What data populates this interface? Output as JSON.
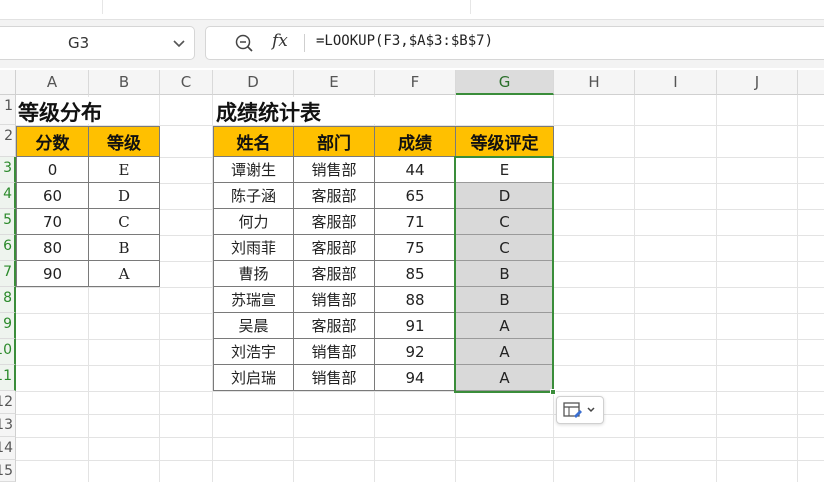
{
  "name_box": {
    "value": "G3"
  },
  "formula_bar": {
    "fx_label": "fx",
    "formula": "=LOOKUP(F3,$A$3:$B$7)"
  },
  "columns": [
    "A",
    "B",
    "C",
    "D",
    "E",
    "F",
    "G",
    "H",
    "I",
    "J"
  ],
  "selected_column": "G",
  "rows": [
    "1",
    "2",
    "3",
    "4",
    "5",
    "6",
    "7",
    "8",
    "9",
    "10",
    "11",
    "12",
    "13",
    "14",
    "15"
  ],
  "grade_table": {
    "title": "等级分布",
    "headers": [
      "分数",
      "等级"
    ],
    "rows": [
      [
        "0",
        "E"
      ],
      [
        "60",
        "D"
      ],
      [
        "70",
        "C"
      ],
      [
        "80",
        "B"
      ],
      [
        "90",
        "A"
      ]
    ]
  },
  "score_table": {
    "title": "成绩统计表",
    "headers": [
      "姓名",
      "部门",
      "成绩",
      "等级评定"
    ],
    "rows": [
      [
        "谭谢生",
        "销售部",
        "44",
        "E"
      ],
      [
        "陈子涵",
        "客服部",
        "65",
        "D"
      ],
      [
        "何力",
        "客服部",
        "71",
        "C"
      ],
      [
        "刘雨菲",
        "客服部",
        "75",
        "C"
      ],
      [
        "曹扬",
        "客服部",
        "85",
        "B"
      ],
      [
        "苏瑞宣",
        "销售部",
        "88",
        "B"
      ],
      [
        "吴晨",
        "客服部",
        "91",
        "A"
      ],
      [
        "刘浩宇",
        "销售部",
        "92",
        "A"
      ],
      [
        "刘启瑞",
        "销售部",
        "94",
        "A"
      ]
    ]
  },
  "colors": {
    "header_fill": "#ffc000",
    "selection": "#3a8d3a",
    "result_fill": "#d9d9d9"
  }
}
